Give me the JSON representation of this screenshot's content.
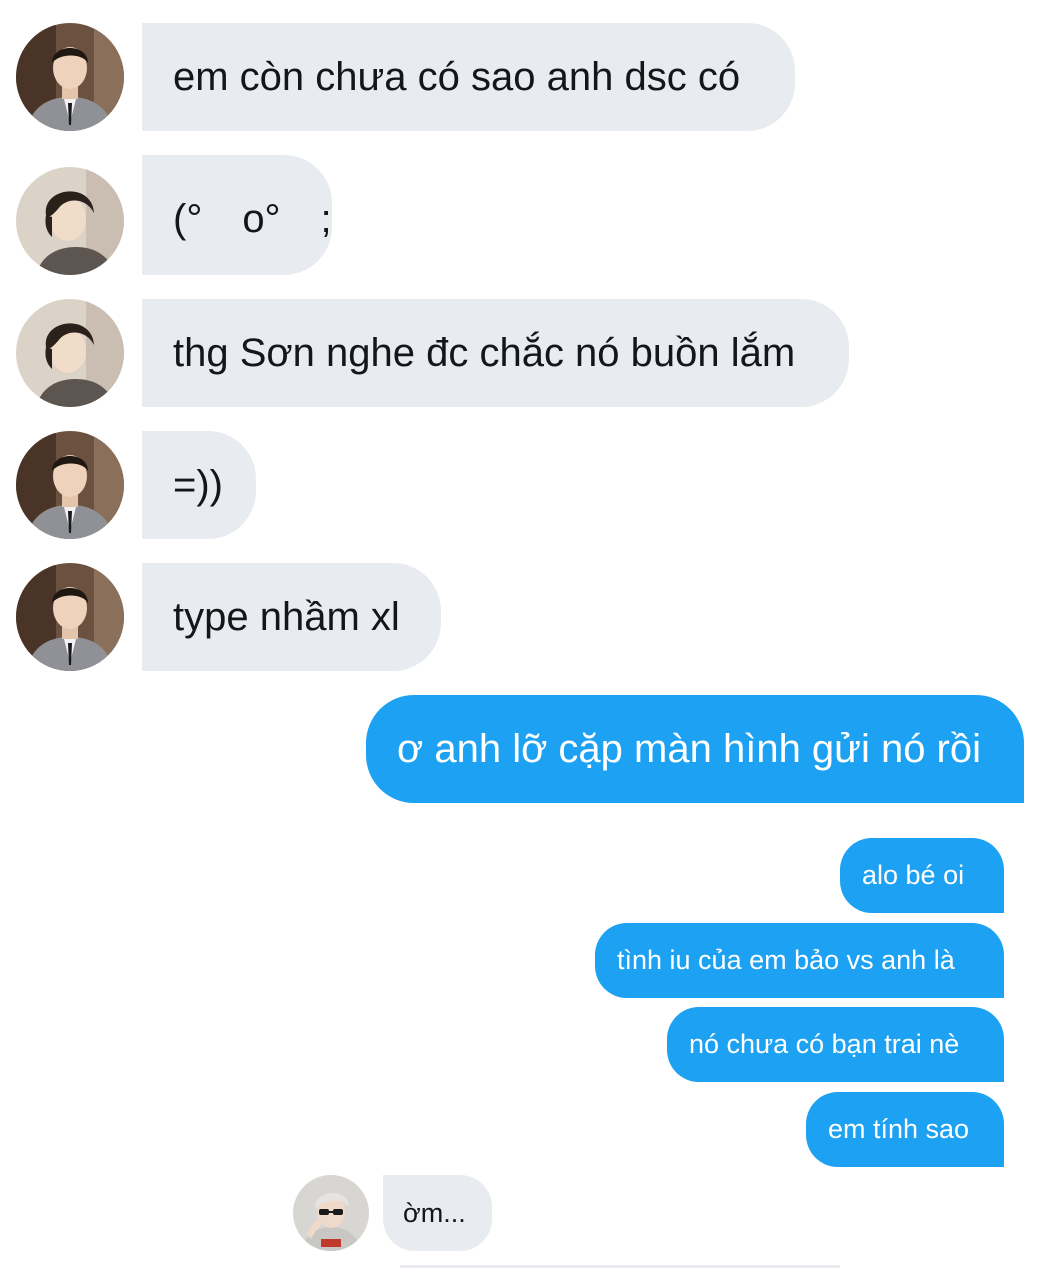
{
  "messages": [
    {
      "direction": "incoming",
      "avatar": "gray-suit-avatar",
      "text": "em còn chưa có sao anh dsc có"
    },
    {
      "direction": "incoming",
      "avatar": "dark-hair-avatar",
      "text": "(°　o°　;"
    },
    {
      "direction": "incoming",
      "avatar": "dark-hair-avatar",
      "text": "thg Sơn nghe đc chắc nó buồn lắm"
    },
    {
      "direction": "incoming",
      "avatar": "gray-suit-avatar",
      "text": "=))"
    },
    {
      "direction": "incoming",
      "avatar": "gray-suit-avatar",
      "text": "type nhầm xl"
    },
    {
      "direction": "outgoing",
      "text": "ơ anh lỡ cặp màn hình gửi nó rồi"
    },
    {
      "direction": "outgoing",
      "text": "alo bé oi"
    },
    {
      "direction": "outgoing",
      "text": "tình iu của em bảo vs anh là"
    },
    {
      "direction": "outgoing",
      "text": "nó chưa có bạn trai nè"
    },
    {
      "direction": "outgoing",
      "text": "em tính sao"
    },
    {
      "direction": "incoming",
      "avatar": "silver-hair-sunglasses-avatar",
      "text": "ờm..."
    }
  ],
  "colors": {
    "incoming_bubble": "#e8ebef",
    "outgoing_bubble": "#1da1f2",
    "incoming_text": "#14171a",
    "outgoing_text": "#ffffff"
  }
}
